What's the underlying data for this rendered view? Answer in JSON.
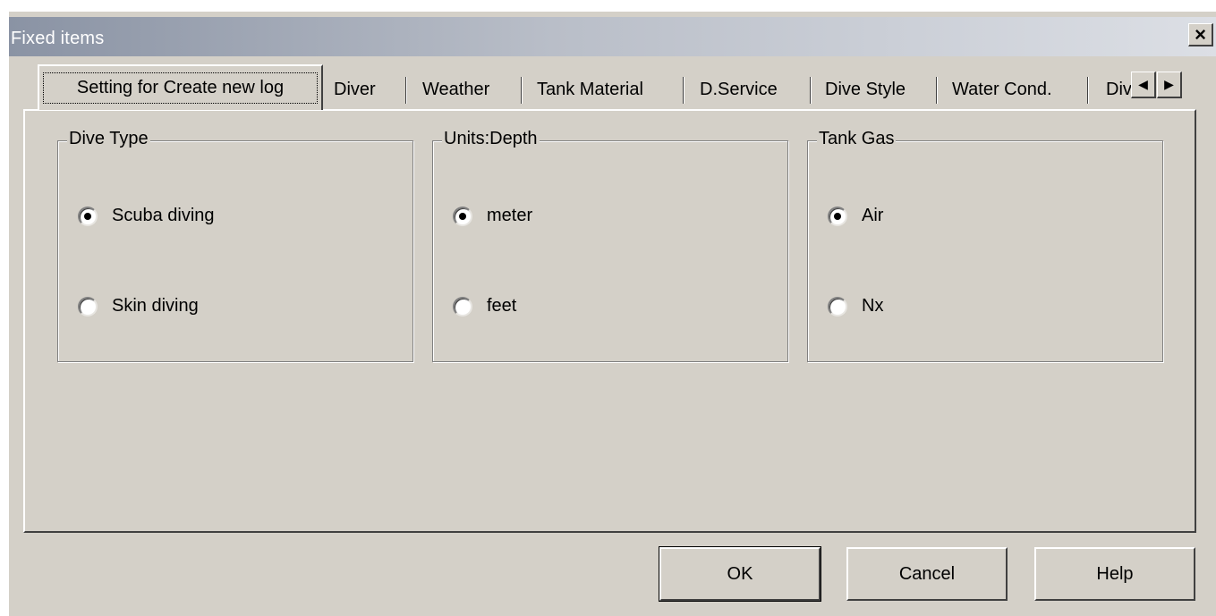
{
  "window": {
    "title": "Fixed items",
    "close_glyph": "×",
    "close_icon": "close-icon"
  },
  "tabs": [
    {
      "label": "Setting for Create new log",
      "active": true
    },
    {
      "label": "Diver",
      "active": false
    },
    {
      "label": "Weather",
      "active": false
    },
    {
      "label": "Tank Material",
      "active": false
    },
    {
      "label": "D.Service",
      "active": false
    },
    {
      "label": "Dive Style",
      "active": false
    },
    {
      "label": "Water Cond.",
      "active": false
    },
    {
      "label": "Div",
      "active": false
    }
  ],
  "tab_scroll": {
    "left_glyph": "◀",
    "right_glyph": "▶",
    "left_icon": "arrow-left-icon",
    "right_icon": "arrow-right-icon"
  },
  "groups": [
    {
      "title": "Dive Type",
      "options": [
        {
          "label": "Scuba diving",
          "checked": true
        },
        {
          "label": "Skin diving",
          "checked": false
        }
      ]
    },
    {
      "title": "Units:Depth",
      "options": [
        {
          "label": "meter",
          "checked": true
        },
        {
          "label": "feet",
          "checked": false
        }
      ]
    },
    {
      "title": "Tank Gas",
      "options": [
        {
          "label": "Air",
          "checked": true
        },
        {
          "label": "Nx",
          "checked": false
        }
      ]
    }
  ],
  "buttons": {
    "ok": "OK",
    "cancel": "Cancel",
    "help": "Help"
  },
  "colors": {
    "face": "#d4d0c8",
    "title_gradient_start": "#8a93a4",
    "title_gradient_end": "#dcdfe5"
  }
}
